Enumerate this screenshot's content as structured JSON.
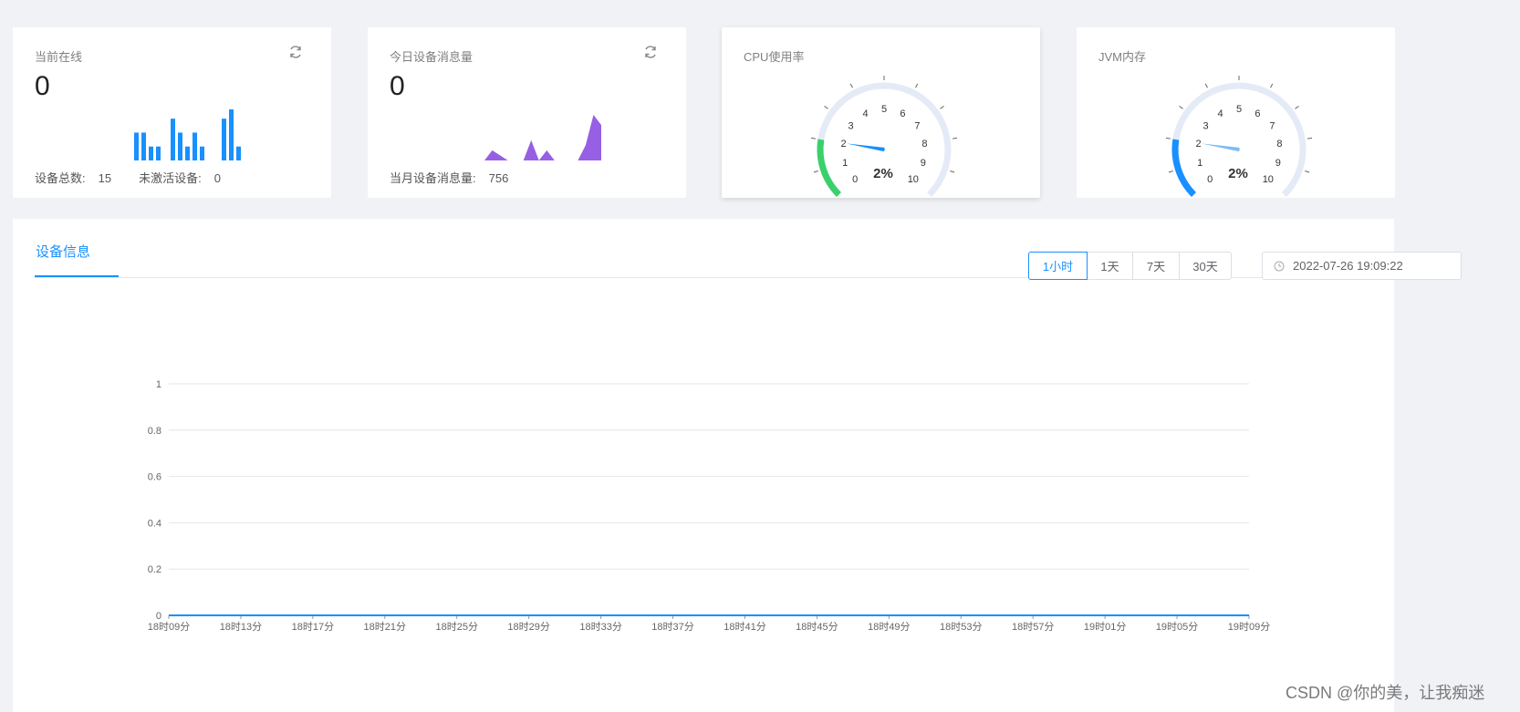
{
  "cards": {
    "online": {
      "title": "当前在线",
      "value": "0",
      "total_label": "设备总数:",
      "total_value": "15",
      "inactive_label": "未激活设备:",
      "inactive_value": "0",
      "bars": [
        6,
        6,
        3,
        3,
        0,
        9,
        6,
        3,
        6,
        3,
        0,
        0,
        9,
        11,
        3
      ],
      "bar_color": "#1890ff"
    },
    "messages": {
      "title": "今日设备消息量",
      "value": "0",
      "month_label": "当月设备消息量:",
      "month_value": "756",
      "area": [
        0,
        2,
        1,
        0,
        0,
        0,
        4,
        0,
        2,
        0,
        0,
        0,
        0,
        3,
        9,
        7
      ],
      "area_color": "#975fe4"
    },
    "cpu": {
      "title": "CPU使用率",
      "percent_label": "2%",
      "value": 2,
      "max": 10,
      "ticks": [
        "0",
        "1",
        "2",
        "3",
        "4",
        "5",
        "6",
        "7",
        "8",
        "9",
        "10"
      ],
      "progress_color": "#3ad06b",
      "track_color": "#e4ebf7",
      "pointer_color": "#1890ff"
    },
    "jvm": {
      "title": "JVM内存",
      "percent_label": "2%",
      "value": 2,
      "max": 10,
      "ticks": [
        "0",
        "1",
        "2",
        "3",
        "4",
        "5",
        "6",
        "7",
        "8",
        "9",
        "10"
      ],
      "progress_color": "#1890ff",
      "track_color": "#e4ebf7",
      "pointer_color": "#7cbcf7"
    }
  },
  "device_panel": {
    "tab_label": "设备信息",
    "ranges": [
      "1小时",
      "1天",
      "7天",
      "30天"
    ],
    "active_range": "1小时",
    "date_value": "2022-07-26 19:09:22"
  },
  "chart_data": {
    "type": "line",
    "x": [
      "18时09分",
      "18时13分",
      "18时17分",
      "18时21分",
      "18时25分",
      "18时29分",
      "18时33分",
      "18时37分",
      "18时41分",
      "18时45分",
      "18时49分",
      "18时53分",
      "18时57分",
      "19时01分",
      "19时05分",
      "19时09分"
    ],
    "yticks": [
      "0",
      "0.2",
      "0.4",
      "0.6",
      "0.8",
      "1"
    ],
    "ylim": [
      0,
      1
    ],
    "series": [
      {
        "values": [
          0,
          0,
          0,
          0,
          0,
          0,
          0,
          0,
          0,
          0,
          0,
          0,
          0,
          0,
          0,
          0
        ]
      }
    ],
    "grid": true,
    "line_color": "#1890ff"
  },
  "watermark": "CSDN @你的美，让我痴迷",
  "colors": {
    "accent": "#1890ff"
  }
}
